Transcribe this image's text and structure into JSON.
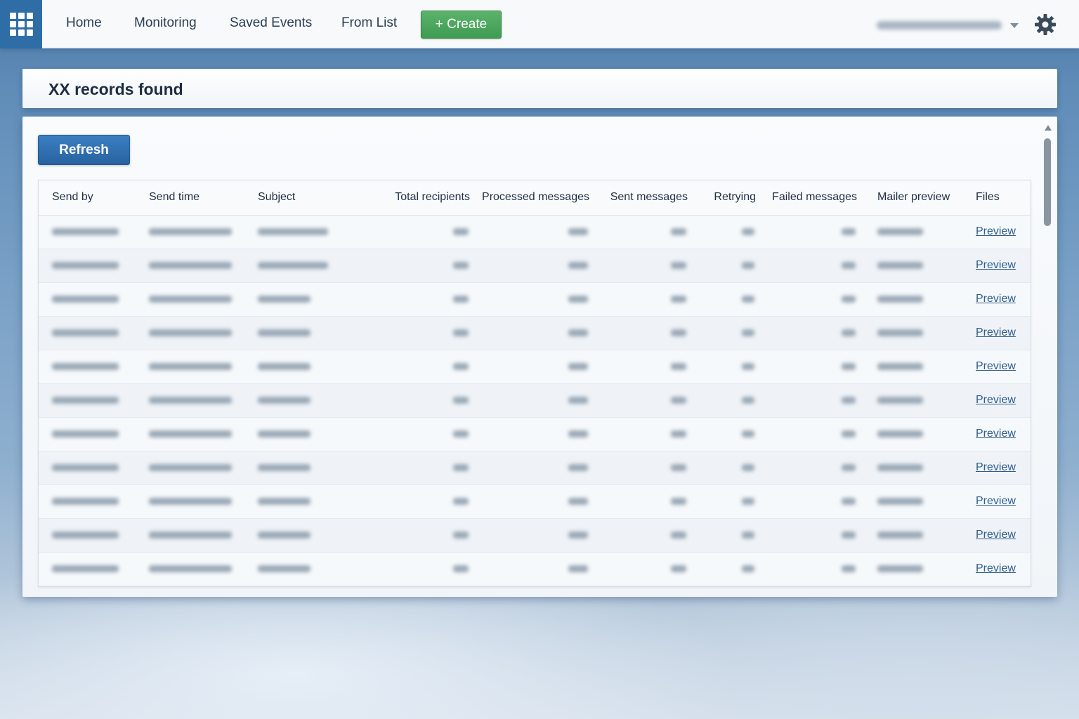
{
  "nav": {
    "items": [
      "Home",
      "Monitoring",
      "Saved Events",
      "From List"
    ],
    "create_label": "+ Create"
  },
  "records": {
    "title": "XX records found",
    "refresh_label": "Refresh"
  },
  "table": {
    "columns": [
      "Send by",
      "Send time",
      "Subject",
      "Total recipients",
      "Processed messages",
      "Sent messages",
      "Retrying",
      "Failed messages",
      "Mailer preview",
      "Files"
    ],
    "link_label": "Preview",
    "row_count": 11
  },
  "colors": {
    "nav_accent": "#2f6da6",
    "create_button": "#4aa65c",
    "refresh_button": "#2f6fb1",
    "link": "#2f5e8e"
  },
  "icons": {
    "app_launcher": "grid-icon",
    "settings": "gear-icon",
    "user_dropdown": "caret-down-icon"
  }
}
